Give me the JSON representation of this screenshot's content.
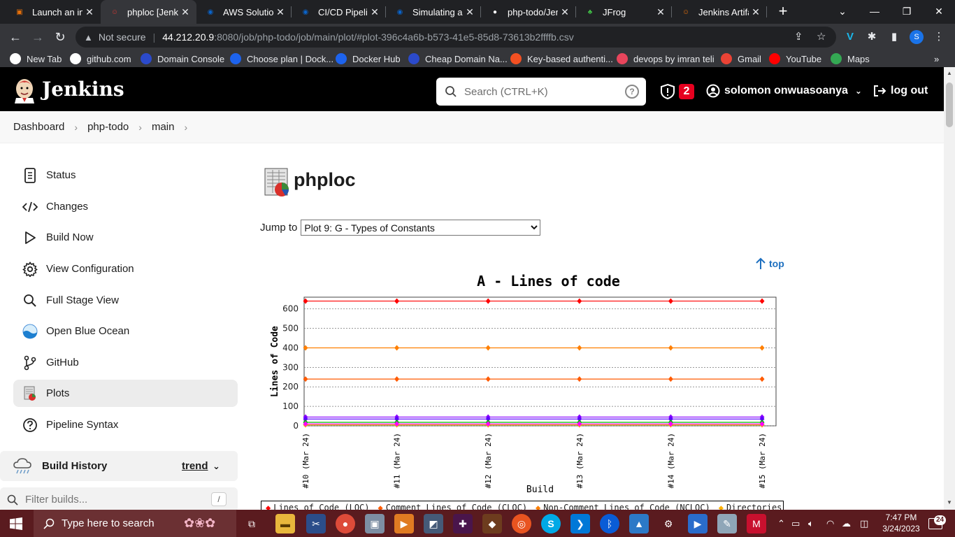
{
  "browser": {
    "tabs": [
      {
        "title": "Launch an ins",
        "icon": "aws-icon",
        "color": "#e8710a"
      },
      {
        "title": "phploc [Jenki",
        "icon": "jenkins-icon",
        "color": "#d33833"
      },
      {
        "title": "AWS Solution",
        "icon": "sharepoint-icon",
        "color": "#0a63c9"
      },
      {
        "title": "CI/CD Pipelin",
        "icon": "sharepoint-icon",
        "color": "#0a63c9"
      },
      {
        "title": "Simulating a",
        "icon": "sharepoint-icon",
        "color": "#0a63c9"
      },
      {
        "title": "php-todo/Jen",
        "icon": "github-icon",
        "color": "#ffffff"
      },
      {
        "title": "JFrog",
        "icon": "jfrog-icon",
        "color": "#40be46"
      },
      {
        "title": "Jenkins Artifa",
        "icon": "jenkins-icon",
        "color": "#e8710a"
      }
    ],
    "url": {
      "security": "Not secure",
      "host": "44.212.20.9",
      "path": ":8080/job/php-todo/job/main/plot/#plot-396c4a6b-b573-41e5-85d8-73613b2ffffb.csv"
    },
    "profile_initial": "S",
    "bookmarks": [
      {
        "label": "New Tab",
        "color": "#ffffff"
      },
      {
        "label": "github.com",
        "color": "#ffffff"
      },
      {
        "label": "Domain Console",
        "color": "#2b4acb"
      },
      {
        "label": "Choose plan | Dock...",
        "color": "#1d63ed"
      },
      {
        "label": "Docker Hub",
        "color": "#1d63ed"
      },
      {
        "label": "Cheap Domain Na...",
        "color": "#2b4acb"
      },
      {
        "label": "Key-based authenti...",
        "color": "#f25022"
      },
      {
        "label": "devops by imran teli",
        "color": "#e8455c"
      },
      {
        "label": "Gmail",
        "color": "#ea4335"
      },
      {
        "label": "YouTube",
        "color": "#ff0000"
      },
      {
        "label": "Maps",
        "color": "#34a853"
      }
    ]
  },
  "jenkins": {
    "title": "Jenkins",
    "search_placeholder": "Search (CTRL+K)",
    "alert_count": "2",
    "user": "solomon onwuasoanya",
    "logout": "log out",
    "breadcrumbs": [
      "Dashboard",
      "php-todo",
      "main"
    ],
    "sidebar": [
      {
        "label": "Status",
        "icon": "status-icon"
      },
      {
        "label": "Changes",
        "icon": "code-icon"
      },
      {
        "label": "Build Now",
        "icon": "play-icon"
      },
      {
        "label": "View Configuration",
        "icon": "gear-icon"
      },
      {
        "label": "Full Stage View",
        "icon": "search-icon"
      },
      {
        "label": "Open Blue Ocean",
        "icon": "blue-ocean-icon"
      },
      {
        "label": "GitHub",
        "icon": "git-branch-icon"
      },
      {
        "label": "Plots",
        "icon": "plot-icon"
      },
      {
        "label": "Pipeline Syntax",
        "icon": "help-icon"
      }
    ],
    "build_history": {
      "title": "Build History",
      "trend": "trend",
      "filter_placeholder": "Filter builds...",
      "filter_shortcut": "/"
    },
    "page_title": "phploc",
    "jump_label": "Jump to",
    "jump_selected": "Plot 9: G - Types of Constants",
    "top_link": "top"
  },
  "chart_data": {
    "type": "line",
    "title": "A - Lines of code",
    "xlabel": "Build",
    "ylabel": "Lines of Code",
    "ylim": [
      0,
      660
    ],
    "yticks": [
      0,
      100,
      200,
      300,
      400,
      500,
      600
    ],
    "categories": [
      "#10 (Mar 24)",
      "#11 (Mar 24)",
      "#12 (Mar 24)",
      "#13 (Mar 24)",
      "#14 (Mar 24)",
      "#15 (Mar 24)"
    ],
    "series": [
      {
        "name": "Lines of Code (LOC)",
        "color": "#ff0000",
        "values": [
          640,
          640,
          640,
          640,
          640,
          640
        ]
      },
      {
        "name": "Comment Lines of Code (CLOC)",
        "color": "#ff5a00",
        "values": [
          240,
          240,
          240,
          240,
          240,
          240
        ]
      },
      {
        "name": "Non-Comment Lines of Code (NCLOC)",
        "color": "#ff7f00",
        "values": [
          400,
          400,
          400,
          400,
          400,
          400
        ]
      },
      {
        "name": "Directories",
        "color": "#ffb000",
        "values": [
          5,
          5,
          5,
          5,
          5,
          5
        ]
      },
      {
        "value_hidden": true,
        "color": "#8a00ff",
        "values": [
          45,
          45,
          45,
          45,
          45,
          45
        ]
      },
      {
        "value_hidden": true,
        "color": "#5a00ff",
        "values": [
          35,
          35,
          35,
          35,
          35,
          35
        ]
      },
      {
        "value_hidden": true,
        "color": "#00c000",
        "values": [
          18,
          18,
          18,
          18,
          18,
          18
        ]
      },
      {
        "value_hidden": true,
        "color": "#ff00ff",
        "values": [
          10,
          10,
          10,
          10,
          10,
          10
        ]
      }
    ],
    "grid": true
  },
  "taskbar": {
    "search_placeholder": "Type here to search",
    "time": "7:47 PM",
    "date": "3/24/2023",
    "notifications": "24"
  }
}
